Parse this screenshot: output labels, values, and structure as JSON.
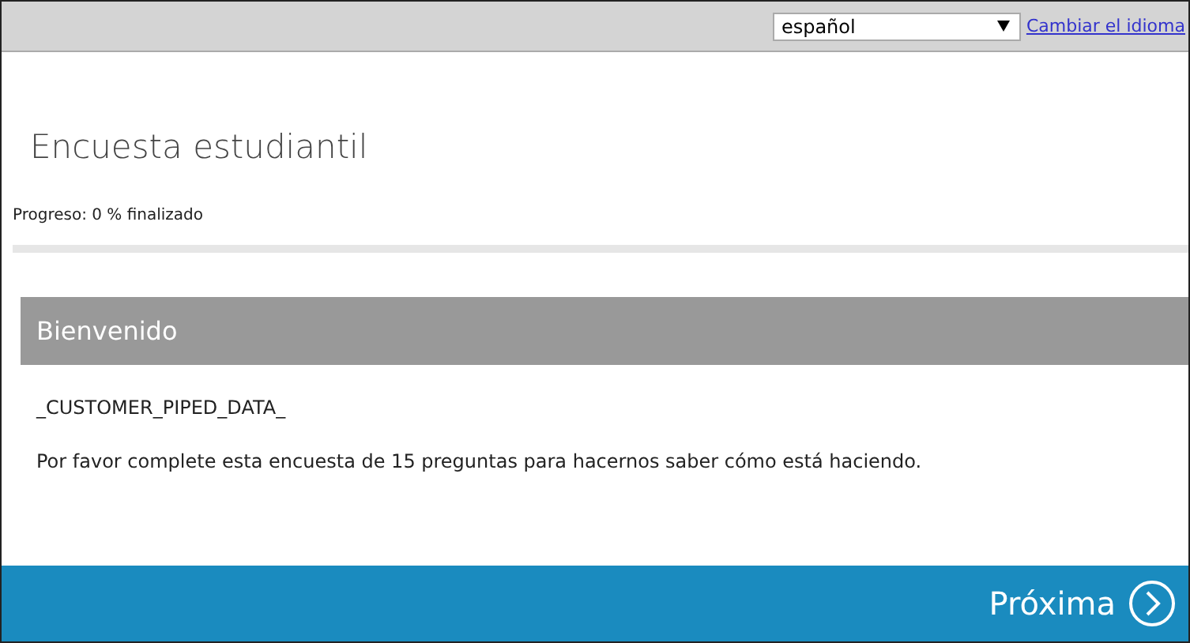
{
  "language_bar": {
    "language": "español",
    "change_link": "Cambiar el idioma"
  },
  "survey": {
    "title": "Encuesta estudiantil",
    "progress_text": "Progreso: 0 % finalizado",
    "progress": {
      "level": 0
    }
  },
  "section": {
    "heading": "Bienvenido",
    "paragraphs": [
      "_CUSTOMER_PIPED_DATA_",
      "Por favor complete esta encuesta de 15 preguntas para hacernos saber cómo está haciendo."
    ]
  },
  "footer": {
    "next_button": "Próxima"
  }
}
